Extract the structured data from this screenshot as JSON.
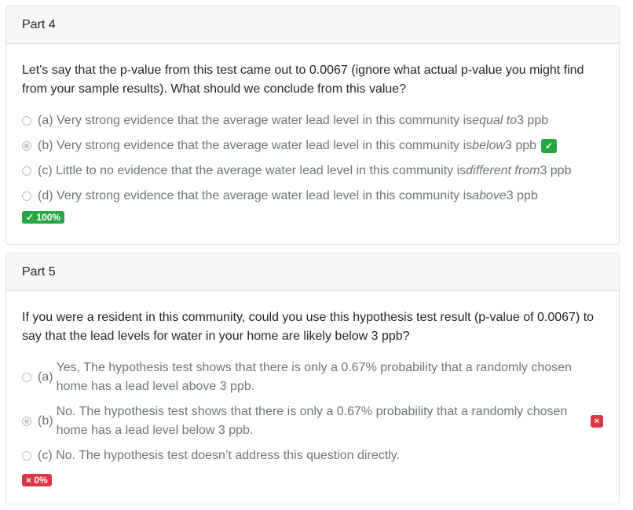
{
  "part4": {
    "header": "Part 4",
    "question": "Let's say that the p-value from this test came out to 0.0067 (ignore what actual p-value you might find from your sample results). What should we conclude from this value?",
    "options": [
      {
        "prefix": "(a) Very strong evidence that the average water lead level in this community is ",
        "emph": "equal to",
        "suffix": " 3 ppb",
        "selected": false
      },
      {
        "prefix": "(b) Very strong evidence that the average water lead level in this community is ",
        "emph": "below",
        "suffix": " 3 ppb",
        "selected": true
      },
      {
        "prefix": "(c) Little to no evidence that the average water lead level in this community is ",
        "emph": "different from",
        "suffix": " 3 ppb",
        "selected": false
      },
      {
        "prefix": "(d) Very strong evidence that the average water lead level in this community is ",
        "emph": "above",
        "suffix": " 3 ppb",
        "selected": false
      }
    ],
    "correct_mark": "✓",
    "score": "✓ 100%"
  },
  "part5": {
    "header": "Part 5",
    "question": "If you were a resident in this community, could you use this hypothesis test result (p-value of 0.0067) to say that the lead levels for water in your home are likely below 3 ppb?",
    "options": [
      {
        "letter": "(a)",
        "text": "Yes, The hypothesis test shows that there is only a 0.67% probability that a randomly chosen home has a lead level above 3 ppb.",
        "selected": false
      },
      {
        "letter": "(b)",
        "text": "No. The hypothesis test shows that there is only a 0.67% probability that a randomly chosen home has a lead level below 3 ppb.",
        "selected": true
      },
      {
        "letter": "",
        "text": "(c) No. The hypothesis test doesn’t address this question directly.",
        "selected": false
      }
    ],
    "wrong_mark": "×",
    "score": "× 0%"
  },
  "colors": {
    "correct": "#28a745",
    "incorrect": "#dc3545",
    "header_bg": "#f7f7f7"
  }
}
